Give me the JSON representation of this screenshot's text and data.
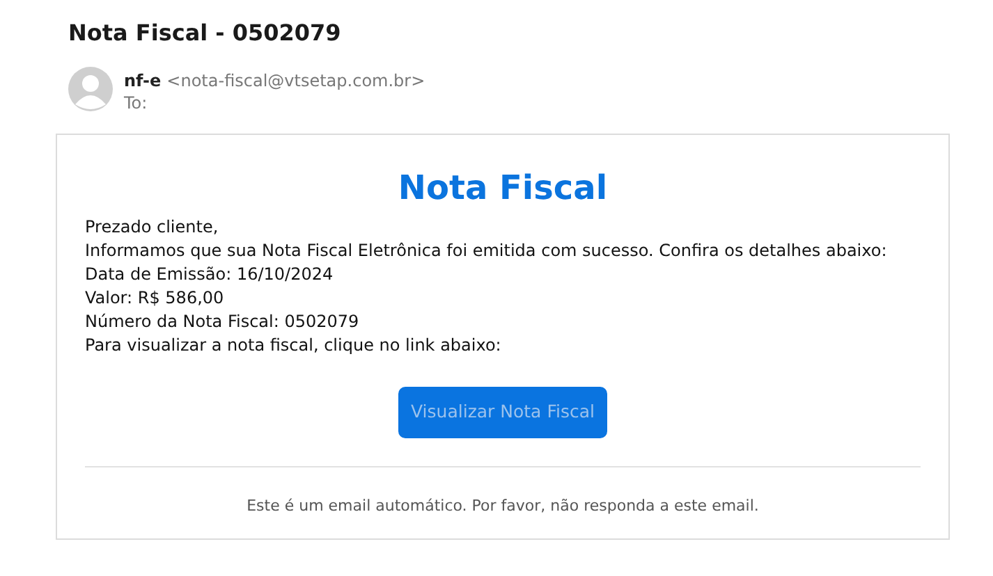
{
  "subject": "Nota Fiscal - 0502079",
  "sender": {
    "name": "nf-e",
    "address": "<nota-fiscal@vtsetap.com.br>",
    "to_label": "To:"
  },
  "email": {
    "heading": "Nota Fiscal",
    "lines": [
      "Prezado cliente,",
      "Informamos que sua Nota Fiscal Eletrônica foi emitida com sucesso. Confira os detalhes abaixo:",
      "Data de Emissão: 16/10/2024",
      "Valor: R$ 586,00",
      "Número da Nota Fiscal: 0502079",
      "Para visualizar a nota fiscal, clique no link abaixo:"
    ],
    "button": "Visualizar Nota Fiscal",
    "footer": "Este é um email automático. Por favor, não responda a este email."
  }
}
